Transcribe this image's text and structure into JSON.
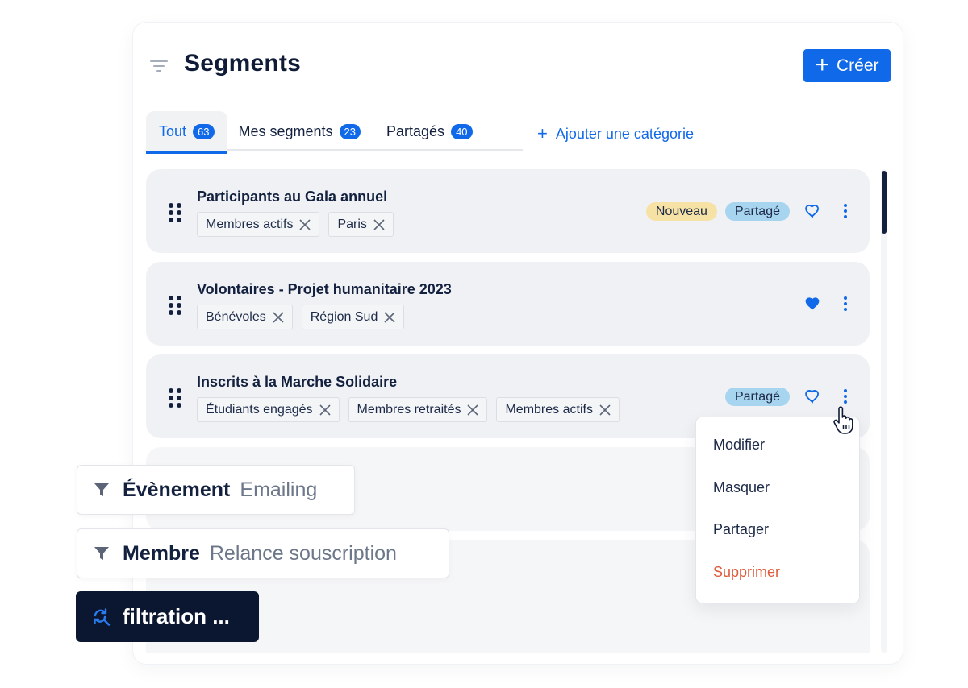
{
  "header": {
    "title": "Segments",
    "create_label": "Créer",
    "filter_icon": "filter-lines-icon"
  },
  "tabs": [
    {
      "label": "Tout",
      "count": "63",
      "active": true
    },
    {
      "label": "Mes segments",
      "count": "23",
      "active": false
    },
    {
      "label": "Partagés",
      "count": "40",
      "active": false
    }
  ],
  "add_category_label": "Ajouter une catégorie",
  "segments": [
    {
      "title": "Participants au Gala annuel",
      "tags": [
        "Membres actifs",
        "Paris"
      ],
      "badges": {
        "new": "Nouveau",
        "shared": "Partagé"
      },
      "favorite": false
    },
    {
      "title": "Volontaires - Projet humanitaire 2023",
      "tags": [
        "Bénévoles",
        "Région Sud"
      ],
      "badges": {},
      "favorite": true
    },
    {
      "title": "Inscrits à la Marche Solidaire",
      "tags": [
        "Étudiants engagés",
        "Membres retraités",
        "Membres actifs"
      ],
      "badges": {
        "shared": "Partagé"
      },
      "favorite": false
    }
  ],
  "context_menu": {
    "items": [
      {
        "label": "Modifier",
        "danger": false
      },
      {
        "label": "Masquer",
        "danger": false
      },
      {
        "label": "Partager",
        "danger": false
      },
      {
        "label": "Supprimer",
        "danger": true
      }
    ]
  },
  "floating_filters": [
    {
      "type": "Évènement",
      "value": "Emailing",
      "icon": "funnel-icon"
    },
    {
      "type": "Membre",
      "value": "Relance souscription",
      "icon": "funnel-icon"
    }
  ],
  "filtration_status": {
    "label": "filtration ...",
    "icon": "sync-search-icon"
  },
  "colors": {
    "primary": "#1069e8",
    "dark": "#0b1730",
    "badge_new": "#f7e2a6",
    "badge_shared": "#a7d4ef",
    "danger": "#e05a3c",
    "row_bg": "#eff1f4"
  }
}
